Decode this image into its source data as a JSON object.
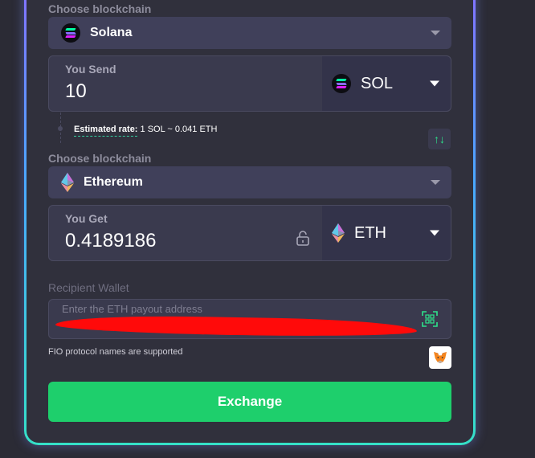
{
  "send_section": {
    "chain_label": "Choose blockchain",
    "chain_name": "Solana",
    "amount_label": "You Send",
    "amount_value": "10",
    "ticker": "SOL"
  },
  "rate": {
    "label": "Estimated rate:",
    "value": "1 SOL ~ 0.041 ETH"
  },
  "receive_section": {
    "chain_label": "Choose blockchain",
    "chain_name": "Ethereum",
    "amount_label": "You Get",
    "amount_value": "0.4189186",
    "ticker": "ETH"
  },
  "wallet": {
    "label": "Recipient Wallet",
    "placeholder": "Enter the ETH payout address",
    "note": "FIO protocol names are supported"
  },
  "exchange_button": "Exchange",
  "icons": {
    "sol": "solana-icon",
    "eth": "ethereum-icon",
    "lock": "unlock-icon",
    "swap": "swap-arrows-icon",
    "qr": "qr-scan-icon",
    "metamask": "metamask-fox-icon"
  },
  "colors": {
    "accent_green": "#1ecf6c",
    "background": "#2b2b35",
    "card": "#30303c"
  }
}
